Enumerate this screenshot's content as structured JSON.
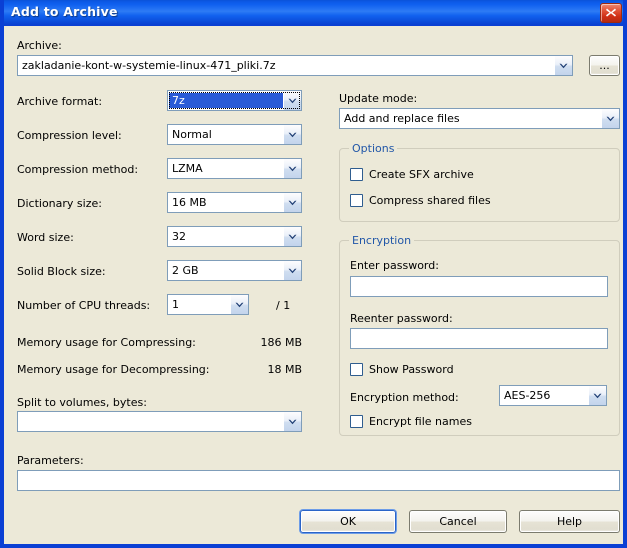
{
  "window": {
    "title": "Add to Archive",
    "close_icon": "close-icon"
  },
  "archive": {
    "label": "Archive:",
    "value": "zakladanie-kont-w-systemie-linux-471_pliki.7z",
    "browse_label": "...",
    "dropdown_icon": "chevron-down-icon"
  },
  "left": {
    "archive_format": {
      "label": "Archive format:",
      "value": "7z"
    },
    "compression_level": {
      "label": "Compression level:",
      "value": "Normal"
    },
    "compression_method": {
      "label": "Compression method:",
      "value": "LZMA"
    },
    "dictionary_size": {
      "label": "Dictionary size:",
      "value": "16 MB"
    },
    "word_size": {
      "label": "Word size:",
      "value": "32"
    },
    "solid_block_size": {
      "label": "Solid Block size:",
      "value": "2 GB"
    },
    "cpu_threads": {
      "label": "Number of CPU threads:",
      "value": "1",
      "total": "/ 1"
    },
    "memory_compressing": {
      "label": "Memory usage for Compressing:",
      "value": "186 MB"
    },
    "memory_decompressing": {
      "label": "Memory usage for Decompressing:",
      "value": "18 MB"
    },
    "split_volumes": {
      "label": "Split to volumes, bytes:",
      "value": ""
    }
  },
  "right": {
    "update_mode": {
      "label": "Update mode:",
      "value": "Add and replace files"
    },
    "options": {
      "legend": "Options",
      "items": [
        {
          "label": "Create SFX archive",
          "checked": false
        },
        {
          "label": "Compress shared files",
          "checked": false
        }
      ]
    },
    "encryption": {
      "legend": "Encryption",
      "enter_password_label": "Enter password:",
      "enter_password_value": "",
      "reenter_password_label": "Reenter password:",
      "reenter_password_value": "",
      "show_password": {
        "label": "Show Password",
        "checked": false
      },
      "method_label": "Encryption method:",
      "method_value": "AES-256",
      "encrypt_file_names": {
        "label": "Encrypt file names",
        "checked": false
      }
    }
  },
  "parameters": {
    "label": "Parameters:",
    "value": ""
  },
  "buttons": {
    "ok": "OK",
    "cancel": "Cancel",
    "help": "Help"
  },
  "colors": {
    "titlebar_blue": "#0a52d8",
    "dialog_bg": "#ece9d8",
    "group_legend_blue": "#2257a8",
    "selection_blue": "#2a5bd7",
    "close_red": "#cf2f16"
  }
}
